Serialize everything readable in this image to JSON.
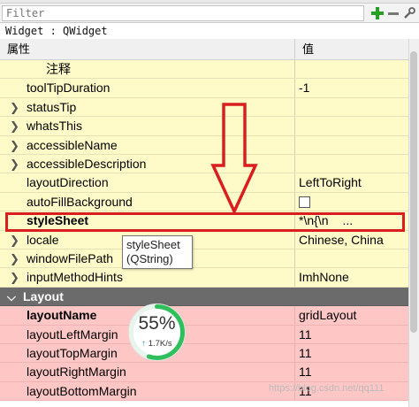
{
  "filter": {
    "placeholder": "Filter"
  },
  "class_line": "Widget : QWidget",
  "header": {
    "property": "属性",
    "value": "值"
  },
  "rows": [
    {
      "label": "注释",
      "value": ""
    },
    {
      "label": "toolTipDuration",
      "value": "-1"
    },
    {
      "label": "statusTip",
      "value": ""
    },
    {
      "label": "whatsThis",
      "value": ""
    },
    {
      "label": "accessibleName",
      "value": ""
    },
    {
      "label": "accessibleDescription",
      "value": ""
    },
    {
      "label": "layoutDirection",
      "value": "LeftToRight"
    },
    {
      "label": "autoFillBackground",
      "value": ""
    },
    {
      "label": "styleSheet",
      "value": "*\\n{\\n",
      "extra": "..."
    },
    {
      "label": "locale",
      "value": "Chinese, China"
    },
    {
      "label": "windowFilePath",
      "value": ""
    },
    {
      "label": "inputMethodHints",
      "value": "ImhNone"
    },
    {
      "label": "Layout",
      "value": ""
    },
    {
      "label": "layoutName",
      "value": "gridLayout"
    },
    {
      "label": "layoutLeftMargin",
      "value": "11"
    },
    {
      "label": "layoutTopMargin",
      "value": "11"
    },
    {
      "label": "layoutRightMargin",
      "value": "11"
    },
    {
      "label": "layoutBottomMargin",
      "value": "11"
    }
  ],
  "tooltip": {
    "line1": "styleSheet",
    "line2": "(QString)"
  },
  "net_widget": {
    "percent": 55,
    "percent_text": "55%",
    "speed": "1.7K/s"
  },
  "watermark": "https://blog.csdn.net/qq111",
  "colors": {
    "yellow": "#fffbc8",
    "pink": "#ffc6c6",
    "section": "#6b6b6b",
    "highlight_red": "#d81e1e",
    "gauge_green": "#2fbf5b",
    "plus_green": "#25a025"
  }
}
